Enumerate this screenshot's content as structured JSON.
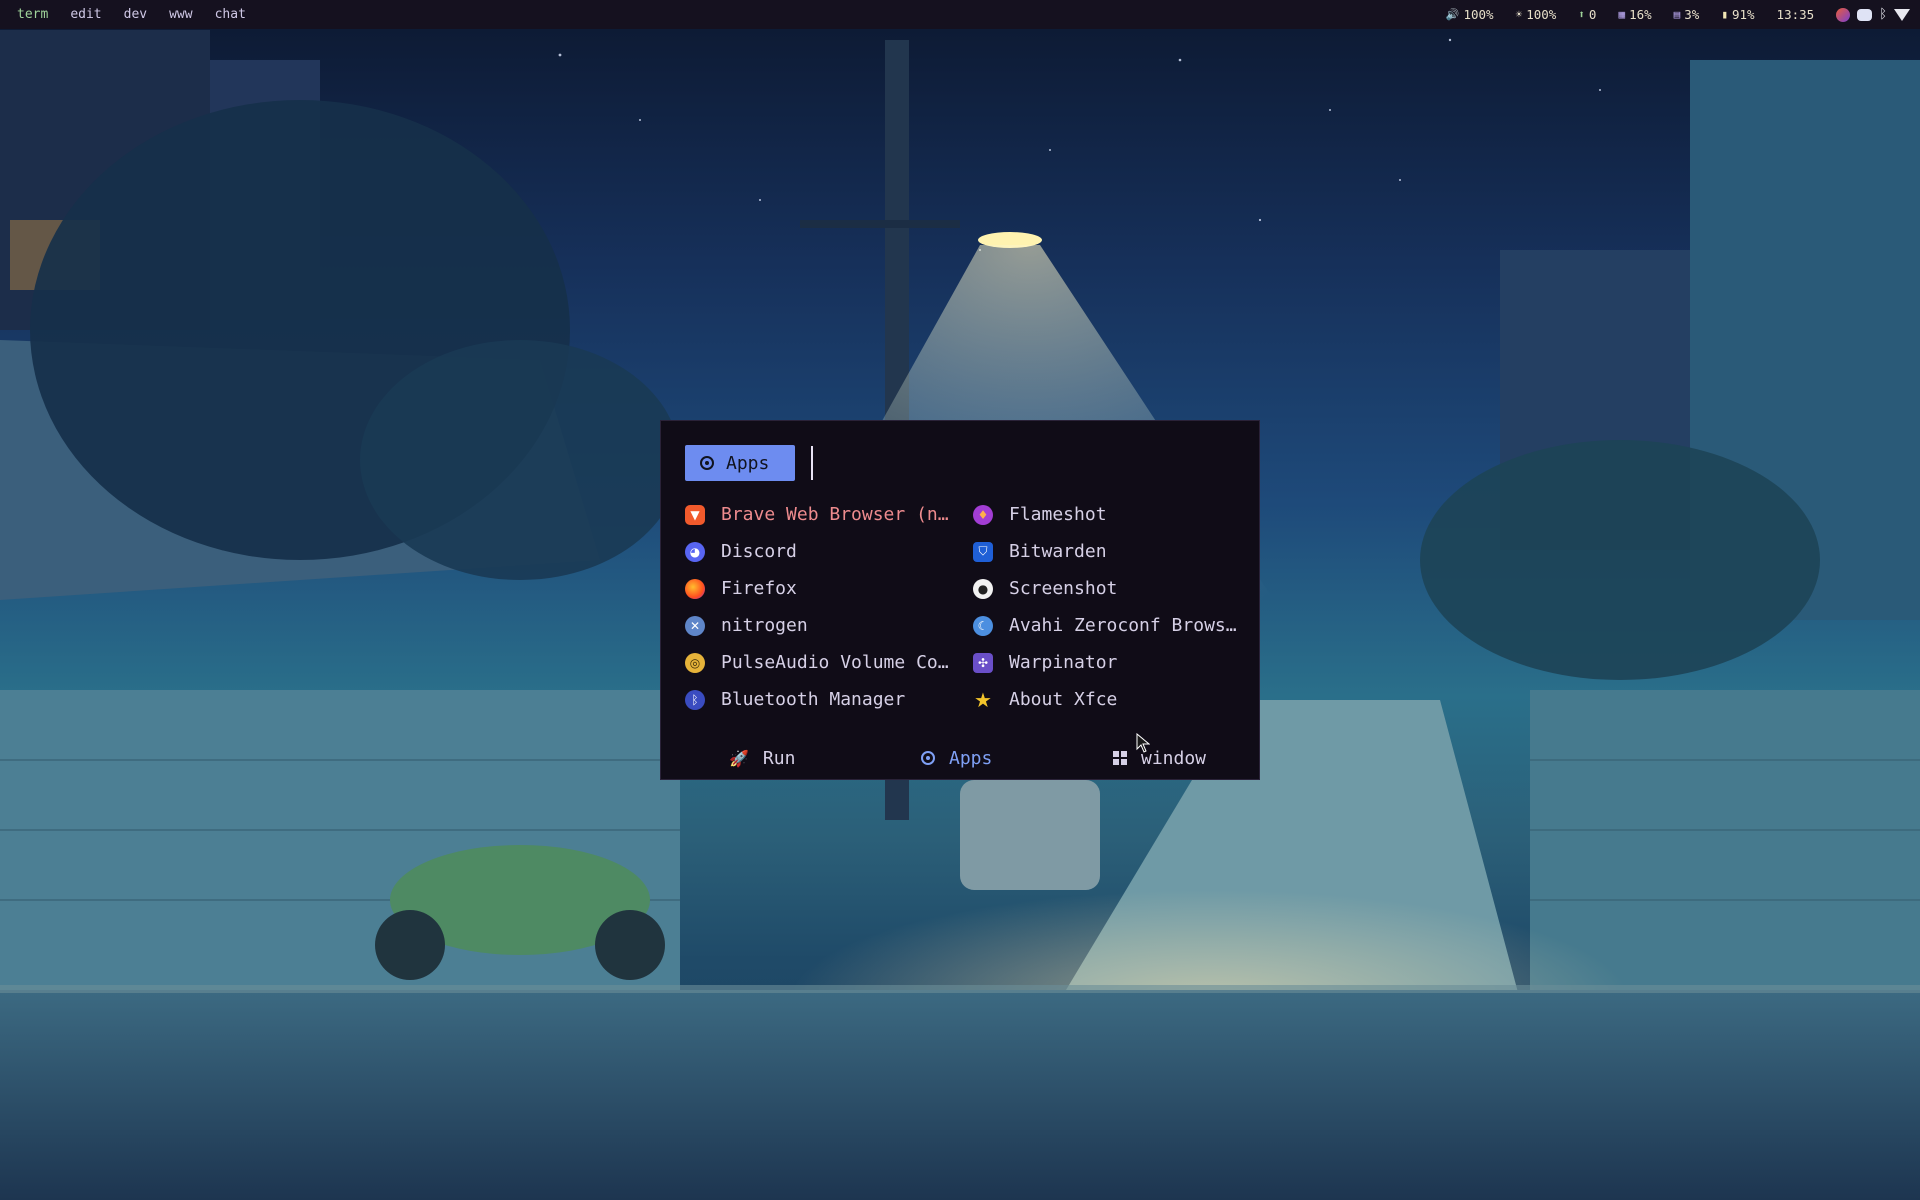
{
  "topbar": {
    "workspaces": [
      "term",
      "edit",
      "dev",
      "www",
      "chat"
    ],
    "active_workspace": "term",
    "status": {
      "volume": "100%",
      "brightness": "100%",
      "updates": "0",
      "cpu": "16%",
      "memory": "3%",
      "battery": "91%",
      "clock": "13:35"
    },
    "status_icons": {
      "volume": "speaker-icon",
      "brightness": "sun-icon",
      "updates": "arrow-up-circle-icon",
      "cpu": "cpu-icon",
      "memory": "memory-icon",
      "battery": "battery-icon"
    },
    "tray": [
      "brave-tray-icon",
      "discord-tray-icon",
      "bluetooth-tray-icon",
      "wifi-tray-icon"
    ]
  },
  "launcher": {
    "mode_badge": "Apps",
    "search_value": "",
    "apps": [
      {
        "label": "Brave Web Browser (new…",
        "icon": "brave-icon",
        "selected": true
      },
      {
        "label": "Discord",
        "icon": "discord-icon"
      },
      {
        "label": "Firefox",
        "icon": "firefox-icon"
      },
      {
        "label": "nitrogen",
        "icon": "nitrogen-icon"
      },
      {
        "label": "PulseAudio Volume Co…",
        "icon": "pulseaudio-icon"
      },
      {
        "label": "Bluetooth Manager",
        "icon": "bluetooth-icon"
      },
      {
        "label": "Flameshot",
        "icon": "flameshot-icon"
      },
      {
        "label": "Bitwarden",
        "icon": "bitwarden-icon"
      },
      {
        "label": "Screenshot",
        "icon": "screenshot-icon"
      },
      {
        "label": "Avahi Zeroconf Brows…",
        "icon": "avahi-icon"
      },
      {
        "label": "Warpinator",
        "icon": "warpinator-icon"
      },
      {
        "label": "About Xfce",
        "icon": "xfce-star-icon"
      }
    ],
    "modes": [
      {
        "label": "Run",
        "icon": "rocket-icon"
      },
      {
        "label": "Apps",
        "icon": "apps-icon",
        "active": true
      },
      {
        "label": "window",
        "icon": "grid-icon"
      }
    ]
  },
  "colors": {
    "bar_bg": "#15111f",
    "launcher_bg": "#100c17",
    "accent": "#6d8cf0",
    "selected_text": "#ee8b8e"
  }
}
